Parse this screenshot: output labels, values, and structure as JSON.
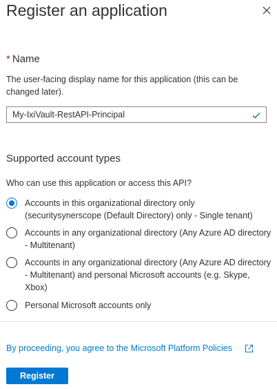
{
  "header": {
    "title": "Register an application",
    "close_icon": "close-icon"
  },
  "name_section": {
    "required_marker": "*",
    "label": "Name",
    "description": "The user-facing display name for this application (this can be changed later).",
    "input_value": "My-IxiVault-RestAPI-Principal",
    "validation_icon": "checkmark-icon"
  },
  "account_types": {
    "title": "Supported account types",
    "question": "Who can use this application or access this API?",
    "options": [
      {
        "label": "Accounts in this organizational directory only (securitysynerscope (Default Directory) only - Single tenant)",
        "selected": true
      },
      {
        "label": "Accounts in any organizational directory (Any Azure AD directory - Multitenant)",
        "selected": false
      },
      {
        "label": "Accounts in any organizational directory (Any Azure AD directory - Multitenant) and personal Microsoft accounts (e.g. Skype, Xbox)",
        "selected": false
      },
      {
        "label": "Personal Microsoft accounts only",
        "selected": false
      }
    ]
  },
  "footer": {
    "policy_text": "By proceeding, you agree to the Microsoft Platform Policies",
    "external_link_icon": "external-link-icon",
    "register_label": "Register"
  },
  "colors": {
    "accent": "#0078d4",
    "required": "#a4262c",
    "success": "#107c10",
    "text": "#323130"
  }
}
